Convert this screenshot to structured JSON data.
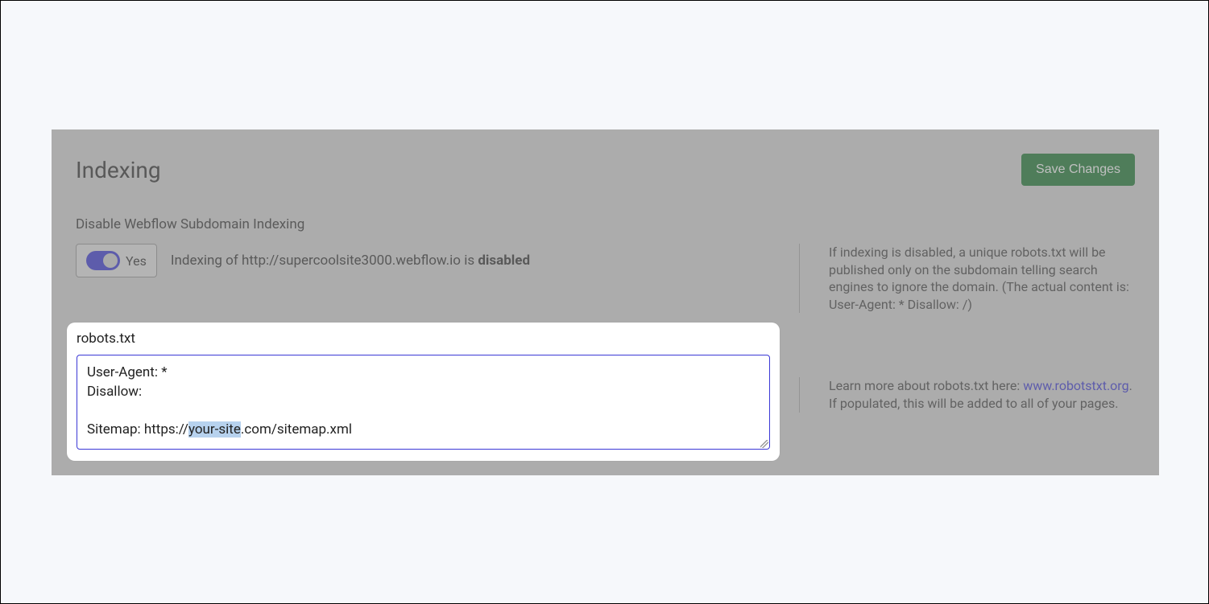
{
  "header": {
    "title": "Indexing",
    "save_label": "Save Changes"
  },
  "subdomain": {
    "section_label": "Disable Webflow Subdomain Indexing",
    "toggle_state": "on",
    "toggle_label": "Yes",
    "status_prefix": "Indexing of ",
    "status_url": "http://supercoolsite3000.webflow.io",
    "status_middle": " is ",
    "status_value": "disabled",
    "info": "If indexing is disabled, a unique robots.txt will be published only on the subdomain telling search engines to ignore the domain. (The actual content is: User-Agent: * Disallow: /)"
  },
  "robots": {
    "label": "robots.txt",
    "line1": "User-Agent: *",
    "line2": "Disallow:",
    "line3_prefix": "Sitemap: https://",
    "line3_highlight": "your-site",
    "line3_suffix": ".com/sitemap.xml",
    "info_prefix": "Learn more about robots.txt here: ",
    "info_link": "www.robotstxt.org",
    "info_suffix": ". If populated, this will be added to all of your pages."
  }
}
